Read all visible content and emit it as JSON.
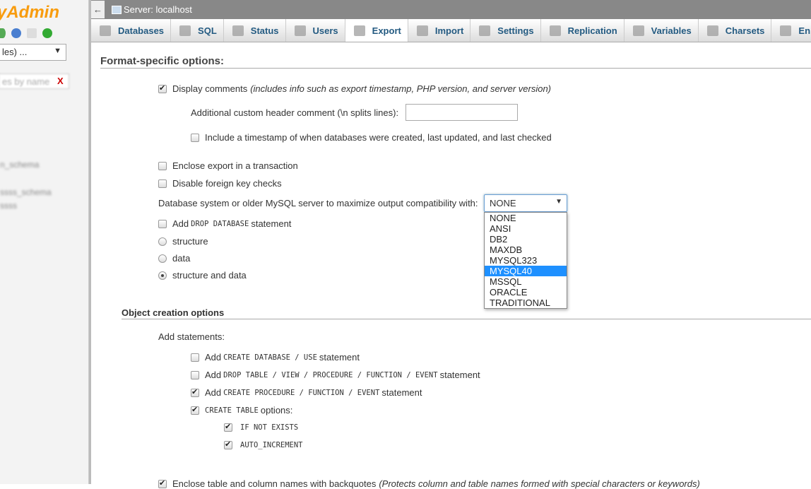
{
  "sidebar": {
    "logo": "yAdmin",
    "db_select": "les) ...",
    "filter_placeholder": "es by name",
    "filter_clear": "X",
    "blurred": [
      "n_schema",
      "ssss_schema",
      "ssss"
    ]
  },
  "topbar": {
    "back": "←",
    "server": "Server: localhost"
  },
  "tabs": [
    "Databases",
    "SQL",
    "Status",
    "Users",
    "Export",
    "Import",
    "Settings",
    "Replication",
    "Variables",
    "Charsets",
    "En"
  ],
  "active_tab": "Export",
  "format": {
    "title": "Format-specific options:",
    "display_comments": {
      "label": "Display comments",
      "note": "(includes info such as export timestamp, PHP version, and server version)",
      "checked": true
    },
    "header_comment_label": "Additional custom header comment (\\n splits lines):",
    "header_comment_value": "",
    "timestamp": {
      "label": "Include a timestamp of when databases were created, last updated, and last checked",
      "checked": false
    },
    "transaction": {
      "label": "Enclose export in a transaction",
      "checked": false
    },
    "fk_checks": {
      "label": "Disable foreign key checks",
      "checked": false
    },
    "compat_label": "Database system or older MySQL server to maximize output compatibility with:",
    "compat_value": "NONE",
    "compat_options": [
      "NONE",
      "ANSI",
      "DB2",
      "MAXDB",
      "MYSQL323",
      "MYSQL40",
      "MSSQL",
      "ORACLE",
      "TRADITIONAL"
    ],
    "compat_highlighted": "MYSQL40",
    "drop_db": {
      "pre": "Add",
      "code": "DROP DATABASE",
      "post": "statement",
      "checked": false
    },
    "radios": [
      {
        "label": "structure",
        "checked": false
      },
      {
        "label": "data",
        "checked": false
      },
      {
        "label": "structure and data",
        "checked": true
      }
    ]
  },
  "object": {
    "title": "Object creation options",
    "add_statements": "Add statements:",
    "items": [
      {
        "pre": "Add",
        "code": "CREATE DATABASE / USE",
        "post": "statement",
        "checked": false
      },
      {
        "pre": "Add",
        "code": "DROP TABLE / VIEW / PROCEDURE / FUNCTION / EVENT",
        "post": "statement",
        "checked": false
      },
      {
        "pre": "Add",
        "code": "CREATE PROCEDURE / FUNCTION / EVENT",
        "post": "statement",
        "checked": true
      },
      {
        "pre": "",
        "code": "CREATE TABLE",
        "post": "options:",
        "checked": true
      }
    ],
    "sub": [
      {
        "code": "IF NOT EXISTS",
        "checked": true
      },
      {
        "code": "AUTO_INCREMENT",
        "checked": true
      }
    ],
    "backquotes": {
      "label": "Enclose table and column names with backquotes",
      "note": "(Protects column and table names formed with special characters or keywords)",
      "checked": true
    }
  }
}
